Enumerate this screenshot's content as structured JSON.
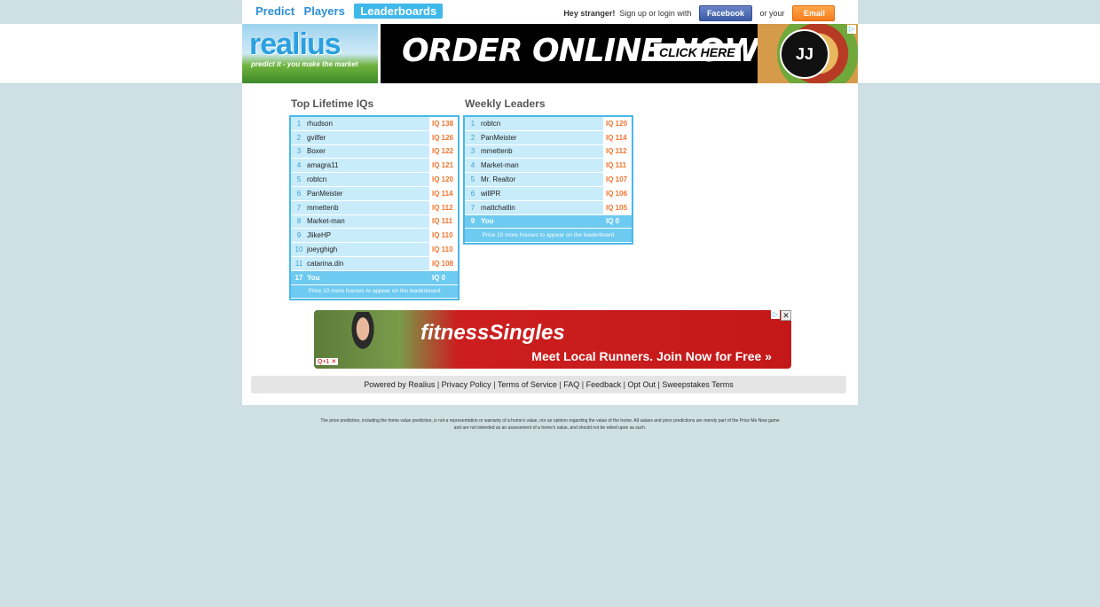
{
  "nav": {
    "items": [
      {
        "label": "Predict",
        "active": false
      },
      {
        "label": "Players",
        "active": false
      },
      {
        "label": "Leaderboards",
        "active": true
      }
    ]
  },
  "login": {
    "greeting": "Hey stranger!",
    "prompt": "Sign up or login with",
    "facebook_label": "Facebook",
    "or_text": "or your",
    "email_label": "Email"
  },
  "logo": {
    "word": "realius",
    "tagline": "predict it - you make the market"
  },
  "ad_top": {
    "headline": "ORDER ONLINE NOW!",
    "cta": "CLICK HERE",
    "badge": "JJ",
    "adchoice": "▷"
  },
  "lifetime": {
    "title": "Top Lifetime IQs",
    "rows": [
      {
        "rank": "1",
        "name": "rhudson",
        "iq": "IQ 138"
      },
      {
        "rank": "2",
        "name": "gvilfer",
        "iq": "IQ 126"
      },
      {
        "rank": "3",
        "name": "Boxer",
        "iq": "IQ 122"
      },
      {
        "rank": "4",
        "name": "amagra11",
        "iq": "IQ 121"
      },
      {
        "rank": "5",
        "name": "robtcn",
        "iq": "IQ 120"
      },
      {
        "rank": "6",
        "name": "PanMeister",
        "iq": "IQ 114"
      },
      {
        "rank": "7",
        "name": "mmettenb",
        "iq": "IQ 112"
      },
      {
        "rank": "8",
        "name": "Market-man",
        "iq": "IQ 111"
      },
      {
        "rank": "9",
        "name": "JlikeHP",
        "iq": "IQ 110"
      },
      {
        "rank": "10",
        "name": "joeyghigh",
        "iq": "IQ 110"
      },
      {
        "rank": "11",
        "name": "catarina.din",
        "iq": "IQ 108"
      }
    ],
    "you": {
      "rank": "17",
      "name": "You",
      "iq": "IQ 0"
    },
    "note": "Price 10 more houses to appear on the leaderboard"
  },
  "weekly": {
    "title": "Weekly Leaders",
    "rows": [
      {
        "rank": "1",
        "name": "robtcn",
        "iq": "IQ 120"
      },
      {
        "rank": "2",
        "name": "PanMeister",
        "iq": "IQ 114"
      },
      {
        "rank": "3",
        "name": "mmettenb",
        "iq": "IQ 112"
      },
      {
        "rank": "4",
        "name": "Market-man",
        "iq": "IQ 111"
      },
      {
        "rank": "5",
        "name": "Mr. Realtor",
        "iq": "IQ 107"
      },
      {
        "rank": "6",
        "name": "willPR",
        "iq": "IQ 106"
      },
      {
        "rank": "7",
        "name": "mattchatlin",
        "iq": "IQ 105"
      }
    ],
    "you": {
      "rank": "9",
      "name": "You",
      "iq": "IQ 0"
    },
    "note": "Price 10 more houses to appear on the leaderboard"
  },
  "ad_bottom": {
    "brand": "fitnessSingles",
    "tagline": "Meet Local Runners. Join Now for Free »",
    "close": "✕",
    "adchoice": "▷",
    "mini": "Q+1 ✕"
  },
  "footer": {
    "links": [
      "Powered by Realius",
      "Privacy Policy",
      "Terms of Service",
      "FAQ",
      "Feedback",
      "Opt Out",
      "Sweepstakes Terms"
    ],
    "separator": " | "
  },
  "disclaimer": "The price prediction, including the home value prediction, is not a representation or warranty of a home's value, nor an opinion regarding the value of the home. All values and price predictions are merely part of the Price Me Now game and are not intended as an assessment of a home's value, and should not be relied upon as such.",
  "colors": {
    "accent": "#3fb8ea",
    "iq": "#f0742c",
    "page_bg": "#cfe0e5"
  }
}
